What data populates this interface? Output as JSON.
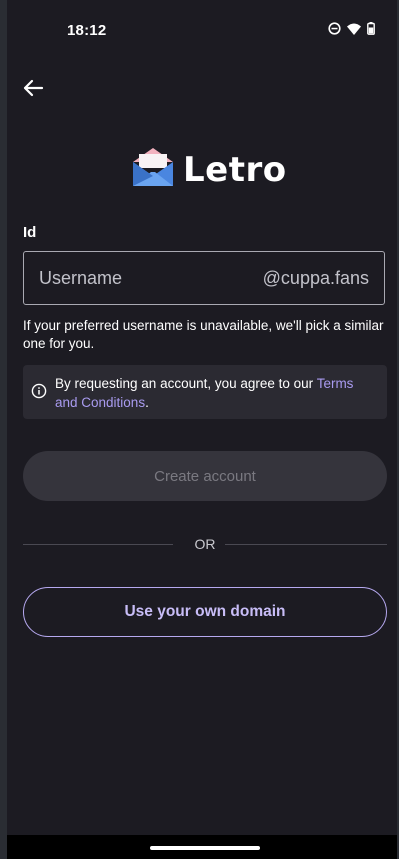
{
  "status_bar": {
    "time": "18:12",
    "icons": [
      "do-not-disturb-icon",
      "wifi-icon",
      "battery-icon"
    ]
  },
  "header": {
    "back_icon": "arrow-left-icon"
  },
  "logo": {
    "icon": "envelope-icon",
    "text": "Letro"
  },
  "form": {
    "id_label": "Id",
    "username_placeholder": "Username",
    "username_value": "",
    "domain_suffix": "@cuppa.fans",
    "helper_text": "If your preferred username is unavailable, we'll pick a similar one for you."
  },
  "terms": {
    "icon": "info-icon",
    "text_before": "By requesting an account, you agree to our ",
    "link_text": "Terms and Conditions",
    "text_after": "."
  },
  "actions": {
    "create_account_label": "Create account",
    "create_account_enabled": false,
    "or_label": "OR",
    "own_domain_label": "Use your own domain"
  },
  "colors": {
    "background": "#1c1b22",
    "accent": "#b6a9f0",
    "link": "#a99bf0",
    "disabled_button": "#35343c"
  }
}
